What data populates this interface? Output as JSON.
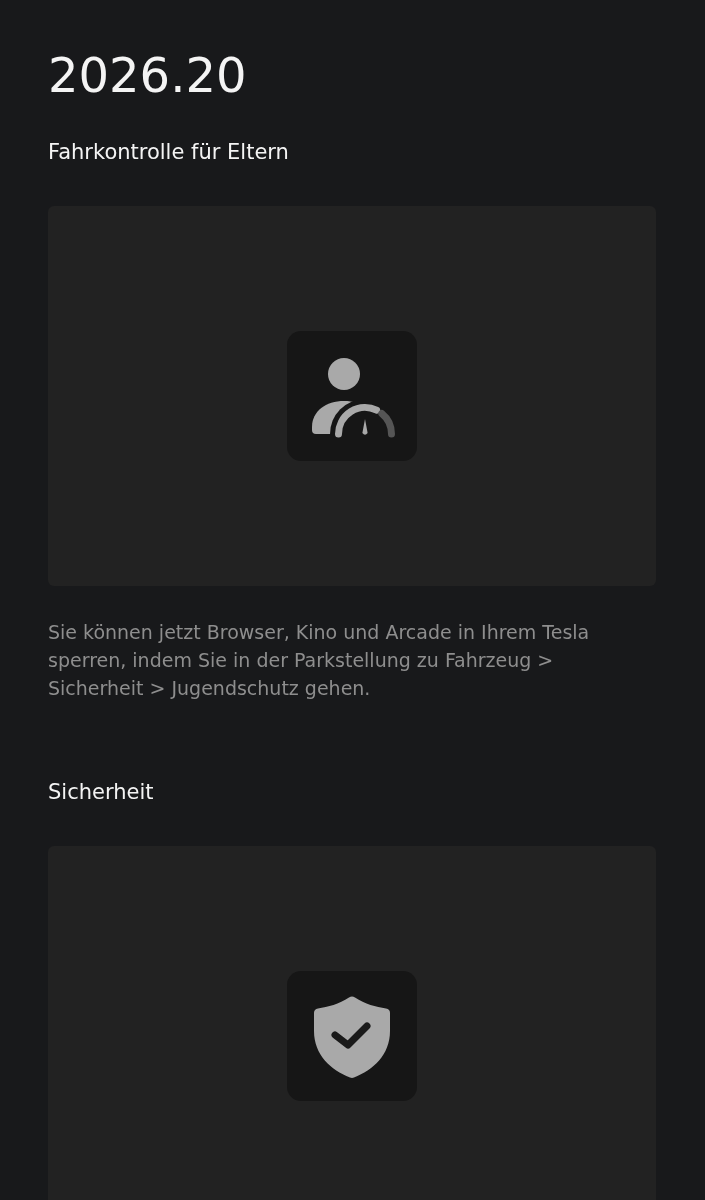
{
  "version": "2026.20",
  "sections": [
    {
      "kind": "parental",
      "heading": "Fahrkontrolle für Eltern",
      "description": "Sie können jetzt Browser, Kino und Arcade in Ihrem Tesla sperren, indem Sie in der Parkstellung zu Fahrzeug > Sicherheit > Jugendschutz gehen."
    },
    {
      "kind": "security",
      "heading": "Sicherheit"
    }
  ]
}
